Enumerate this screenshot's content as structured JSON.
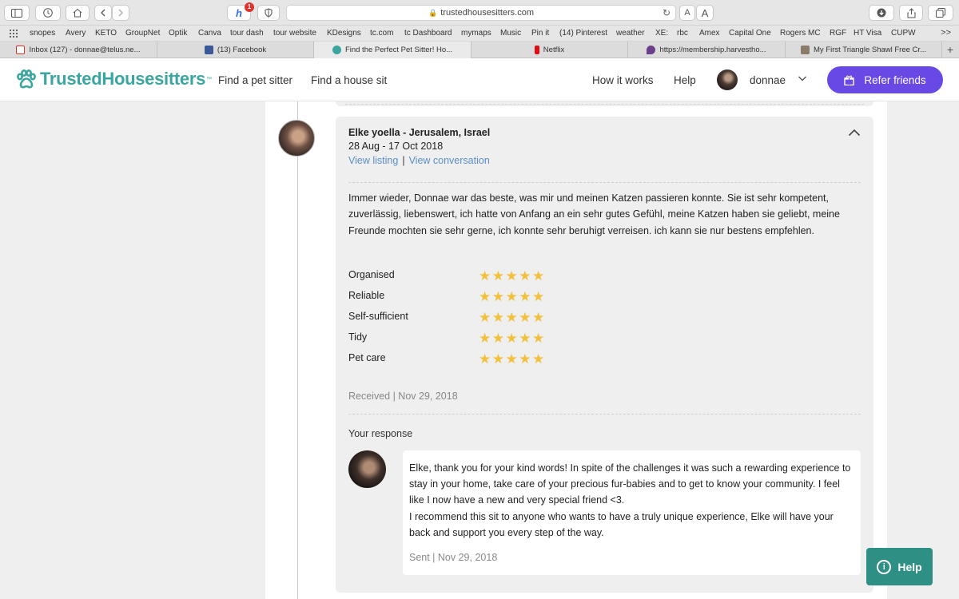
{
  "browser": {
    "url": "trustedhousesitters.com",
    "notification_count": "1",
    "font_smaller": "A",
    "font_larger": "A",
    "favorites": [
      "snopes",
      "Avery",
      "KETO",
      "GroupNet",
      "Optik",
      "Canva",
      "tour dash",
      "tour website",
      "KDesigns",
      "tc.com",
      "tc Dashboard",
      "mymaps",
      "Music",
      "Pin it",
      "(14) Pinterest",
      "weather",
      "XE:",
      "rbc",
      "Amex",
      "Capital One",
      "Rogers MC",
      "RGF",
      "HT Visa",
      "CUPW"
    ],
    "favorites_more": ">>",
    "tabs": [
      {
        "label": "Inbox (127) - donnae@telus.ne...",
        "icon_color": "#d93025"
      },
      {
        "label": "(13) Facebook",
        "icon_color": "#3b5998"
      },
      {
        "label": "Find the Perfect Pet Sitter! Ho...",
        "icon_color": "#3ba6a0"
      },
      {
        "label": "Netflix",
        "icon_color": "#e50914"
      },
      {
        "label": "https://membership.harvestho...",
        "icon_color": "#6b3f8c"
      },
      {
        "label": "My First Triangle Shawl Free Cr...",
        "icon_color": "#8a7b6a"
      }
    ],
    "new_tab": "+"
  },
  "site": {
    "logo_text": "TrustedHousesitters",
    "logo_tm": "™",
    "brand_color": "#3ba6a0",
    "nav": {
      "find_sitter": "Find a pet sitter",
      "find_house": "Find a house sit",
      "how_it_works": "How it works",
      "help": "Help"
    },
    "username": "donnae",
    "refer_label": "Refer friends",
    "refer_color": "#6949e6"
  },
  "review": {
    "reviewer": "Elke yoella - Jerusalem, Israel",
    "dates": "28 Aug - 17 Oct 2018",
    "view_listing": "View listing",
    "separator": "|",
    "view_conversation": "View conversation",
    "body": "Immer wieder, Donnae war das beste, was mir und meinen Katzen passieren konnte. Sie ist sehr kompetent, zuverlässig, liebenswert, ich hatte von Anfang an ein sehr gutes Gefühl, meine Katzen haben sie geliebt, meine Freunde mochten sie sehr gerne, ich konnte sehr beruhigt verreisen. ich kann sie nur bestens empfehlen.",
    "ratings": [
      {
        "label": "Organised",
        "stars": "★★★★★",
        "score": 5
      },
      {
        "label": "Reliable",
        "stars": "★★★★★",
        "score": 5
      },
      {
        "label": "Self-sufficient",
        "stars": "★★★★★",
        "score": 5
      },
      {
        "label": "Tidy",
        "stars": "★★★★★",
        "score": 5
      },
      {
        "label": "Pet care",
        "stars": "★★★★★",
        "score": 5
      }
    ],
    "star_color": "#f3c03b",
    "received": "Received | Nov 29, 2018",
    "response_label": "Your response",
    "response_line1": "Elke, thank you for your kind words! In spite of the challenges it was such a rewarding experience to stay in your home, take care of your precious fur-babies and to get to know your community. I feel like I now have a new and very special friend <3.",
    "response_line2": "I recommend this sit to anyone who wants to have a truly unique experience, Elke will have your back and support you every step of the way.",
    "sent": "Sent | Nov 29, 2018"
  },
  "help_button": {
    "label": "Help",
    "color": "#2e8f84"
  }
}
